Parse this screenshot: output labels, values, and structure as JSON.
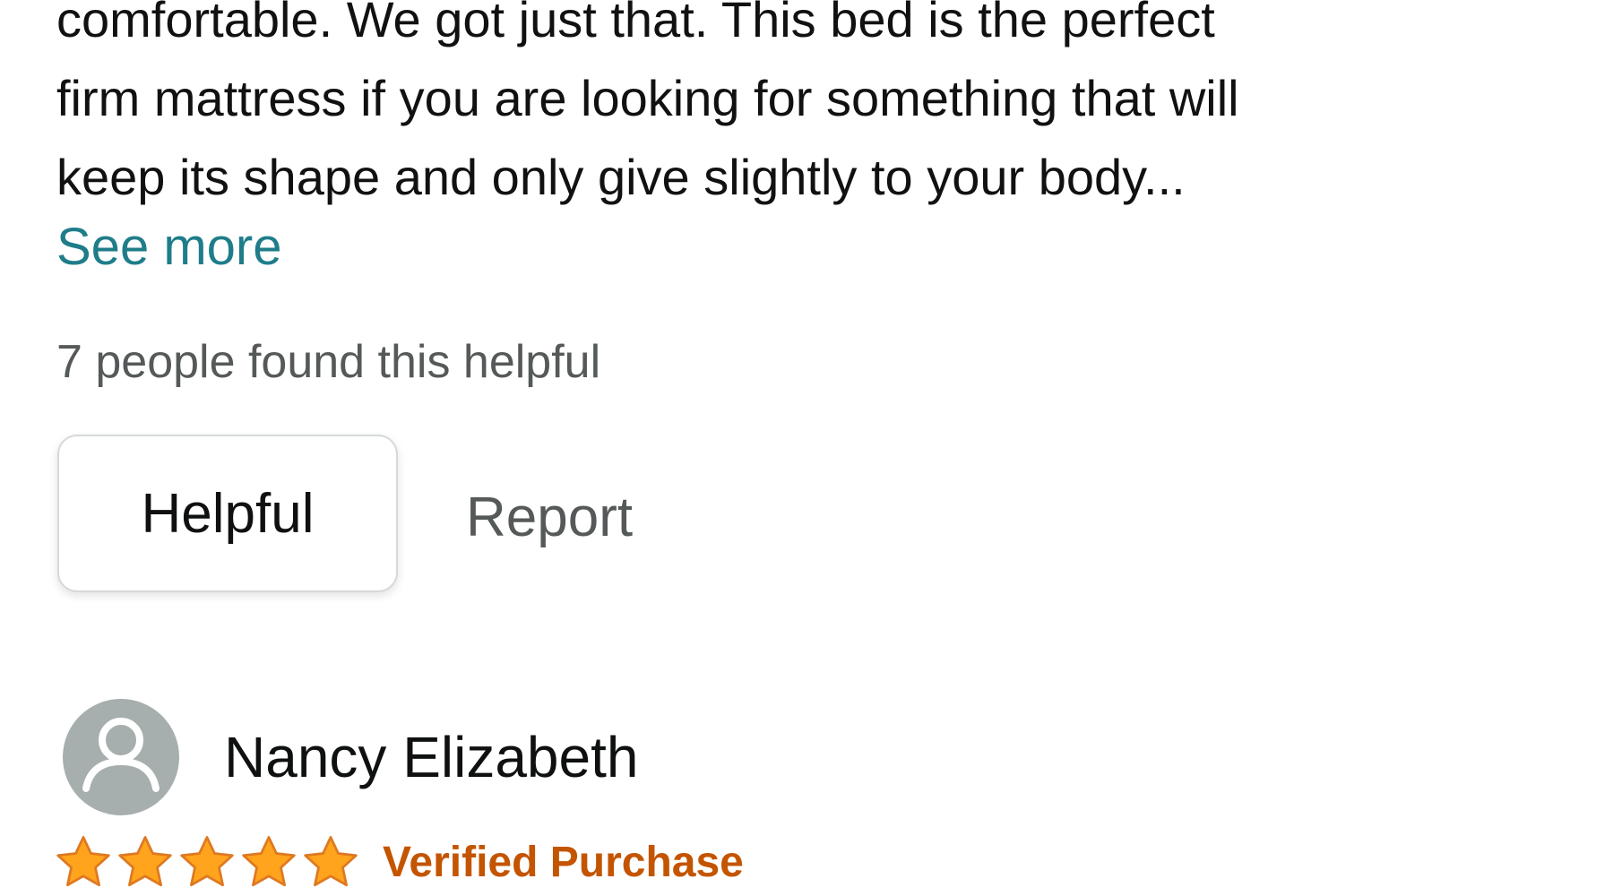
{
  "review": {
    "body_lines": [
      "comfortable. We got just that. This bed is the perfect",
      "firm mattress if you are looking for something that will",
      "keep its shape and only give slightly to your body..."
    ],
    "see_more_label": "See more",
    "helpful_count_text": "7 people found this helpful",
    "helpful_button_label": "Helpful",
    "report_label": "Report"
  },
  "next_review": {
    "reviewer_name": "Nancy Elizabeth",
    "avatar_icon": "default-user-avatar-icon",
    "rating": 5,
    "rating_max": 5,
    "badge_label": "Verified Purchase"
  },
  "colors": {
    "link": "#1f7d8a",
    "secondary_text": "#565959",
    "star": "#ffa41c",
    "star_outline": "#de7921",
    "badge": "#c45500",
    "avatar_bg": "#a6aeae"
  }
}
